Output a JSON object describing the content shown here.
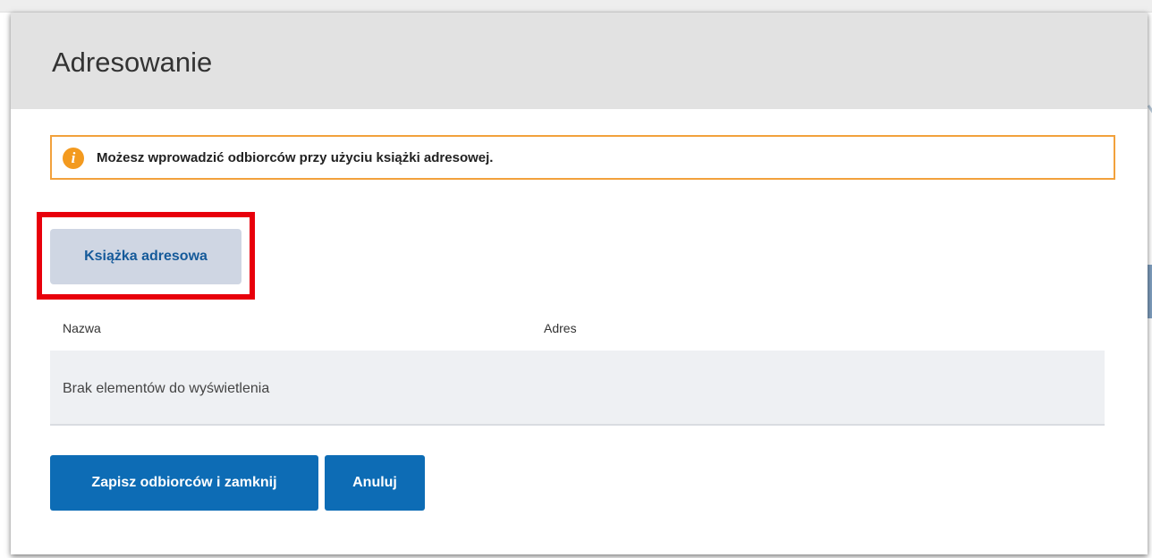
{
  "dialog": {
    "title": "Adresowanie",
    "info_message": "Możesz wprowadzić odbiorców przy użyciu książki adresowej.",
    "address_book_button": "Książka adresowa",
    "table": {
      "columns": [
        "Nazwa",
        "Adres"
      ],
      "empty_message": "Brak elementów do wyświetlenia"
    },
    "save_button": "Zapisz odbiorców i zamknij",
    "cancel_button": "Anuluj"
  },
  "colors": {
    "accent": "#0d6cb5",
    "warning": "#f39a1f",
    "highlight": "#e8000b"
  },
  "icons": {
    "info": "info-icon"
  }
}
